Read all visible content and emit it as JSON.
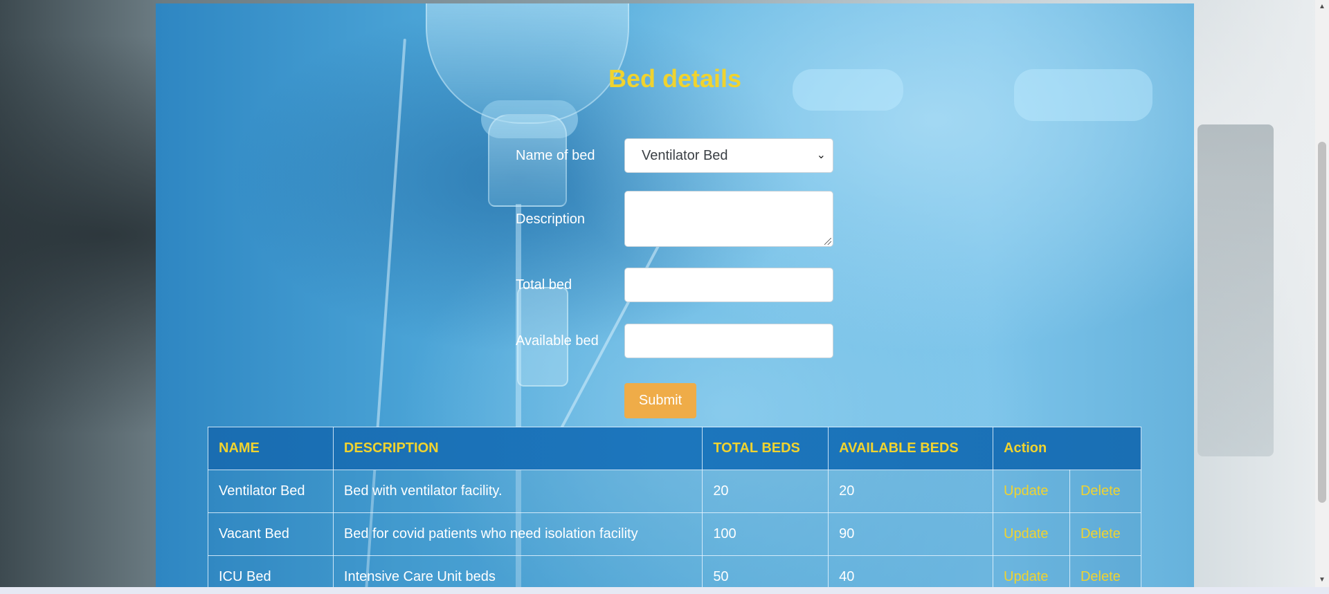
{
  "page": {
    "title": "Bed details"
  },
  "form": {
    "name_label": "Name of bed",
    "name_selected": "Ventilator Bed",
    "description_label": "Description",
    "description_value": "",
    "total_label": "Total bed",
    "total_value": "",
    "available_label": "Available bed",
    "available_value": "",
    "submit_label": "Submit"
  },
  "table": {
    "headers": [
      "NAME",
      "DESCRIPTION",
      "TOTAL BEDS",
      "AVAILABLE BEDS",
      "Action"
    ],
    "rows": [
      {
        "name": "Ventilator Bed",
        "description": "Bed with ventilator facility.",
        "total": "20",
        "available": "20",
        "update": "Update",
        "delete": "Delete"
      },
      {
        "name": "Vacant Bed",
        "description": "Bed for covid patients who need isolation facility",
        "total": "100",
        "available": "90",
        "update": "Update",
        "delete": "Delete"
      },
      {
        "name": "ICU Bed",
        "description": "Intensive Care Unit beds",
        "total": "50",
        "available": "40",
        "update": "Update",
        "delete": "Delete"
      }
    ]
  },
  "colors": {
    "title": "#f0d32f",
    "header_text": "#f0d32f",
    "submit_bg": "#efac48",
    "panel": "#4aa3d6"
  },
  "icons": {
    "select_chevron": "chevron-down-icon",
    "textarea_resize": "resize-grip-icon",
    "scroll_up": "arrow-up-icon",
    "scroll_down": "arrow-down-icon"
  }
}
